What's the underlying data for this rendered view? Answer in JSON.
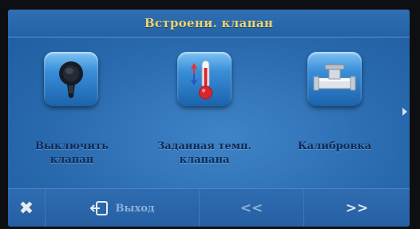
{
  "screen": {
    "title": "Встроени. клапан"
  },
  "tiles": [
    {
      "icon": "valve-handle-icon",
      "label_line1": "Выключить",
      "label_line2": "клапан"
    },
    {
      "icon": "thermometer-icon",
      "label_line1": "Заданная темп.",
      "label_line2": "клапана"
    },
    {
      "icon": "pipe-valve-icon",
      "label_line1": "Калибровка",
      "label_line2": ""
    }
  ],
  "bottom_bar": {
    "close_symbol": "✖",
    "exit_label": "Выход",
    "prev_label": "<<",
    "next_label": ">>"
  },
  "colors": {
    "title_text": "#f0d36a",
    "label_text": "#0f2a55",
    "screen_bg": "#2868ad"
  }
}
